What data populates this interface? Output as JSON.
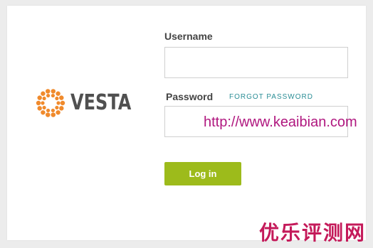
{
  "logo": {
    "text": "VESTA",
    "icon": "vesta-ring-icon",
    "colors": {
      "ring": "#f08a2c",
      "text": "#505050"
    }
  },
  "form": {
    "username_label": "Username",
    "username_value": "",
    "password_label": "Password",
    "password_value": "",
    "forgot_link": "FORGOT PASSWORD",
    "login_button": "Log in"
  },
  "colors": {
    "button": "#9dbb1b",
    "link": "#2b8e96",
    "background": "#ececec"
  },
  "watermark": {
    "url": "http://www.keaibian.com",
    "text": "优乐评测网"
  }
}
